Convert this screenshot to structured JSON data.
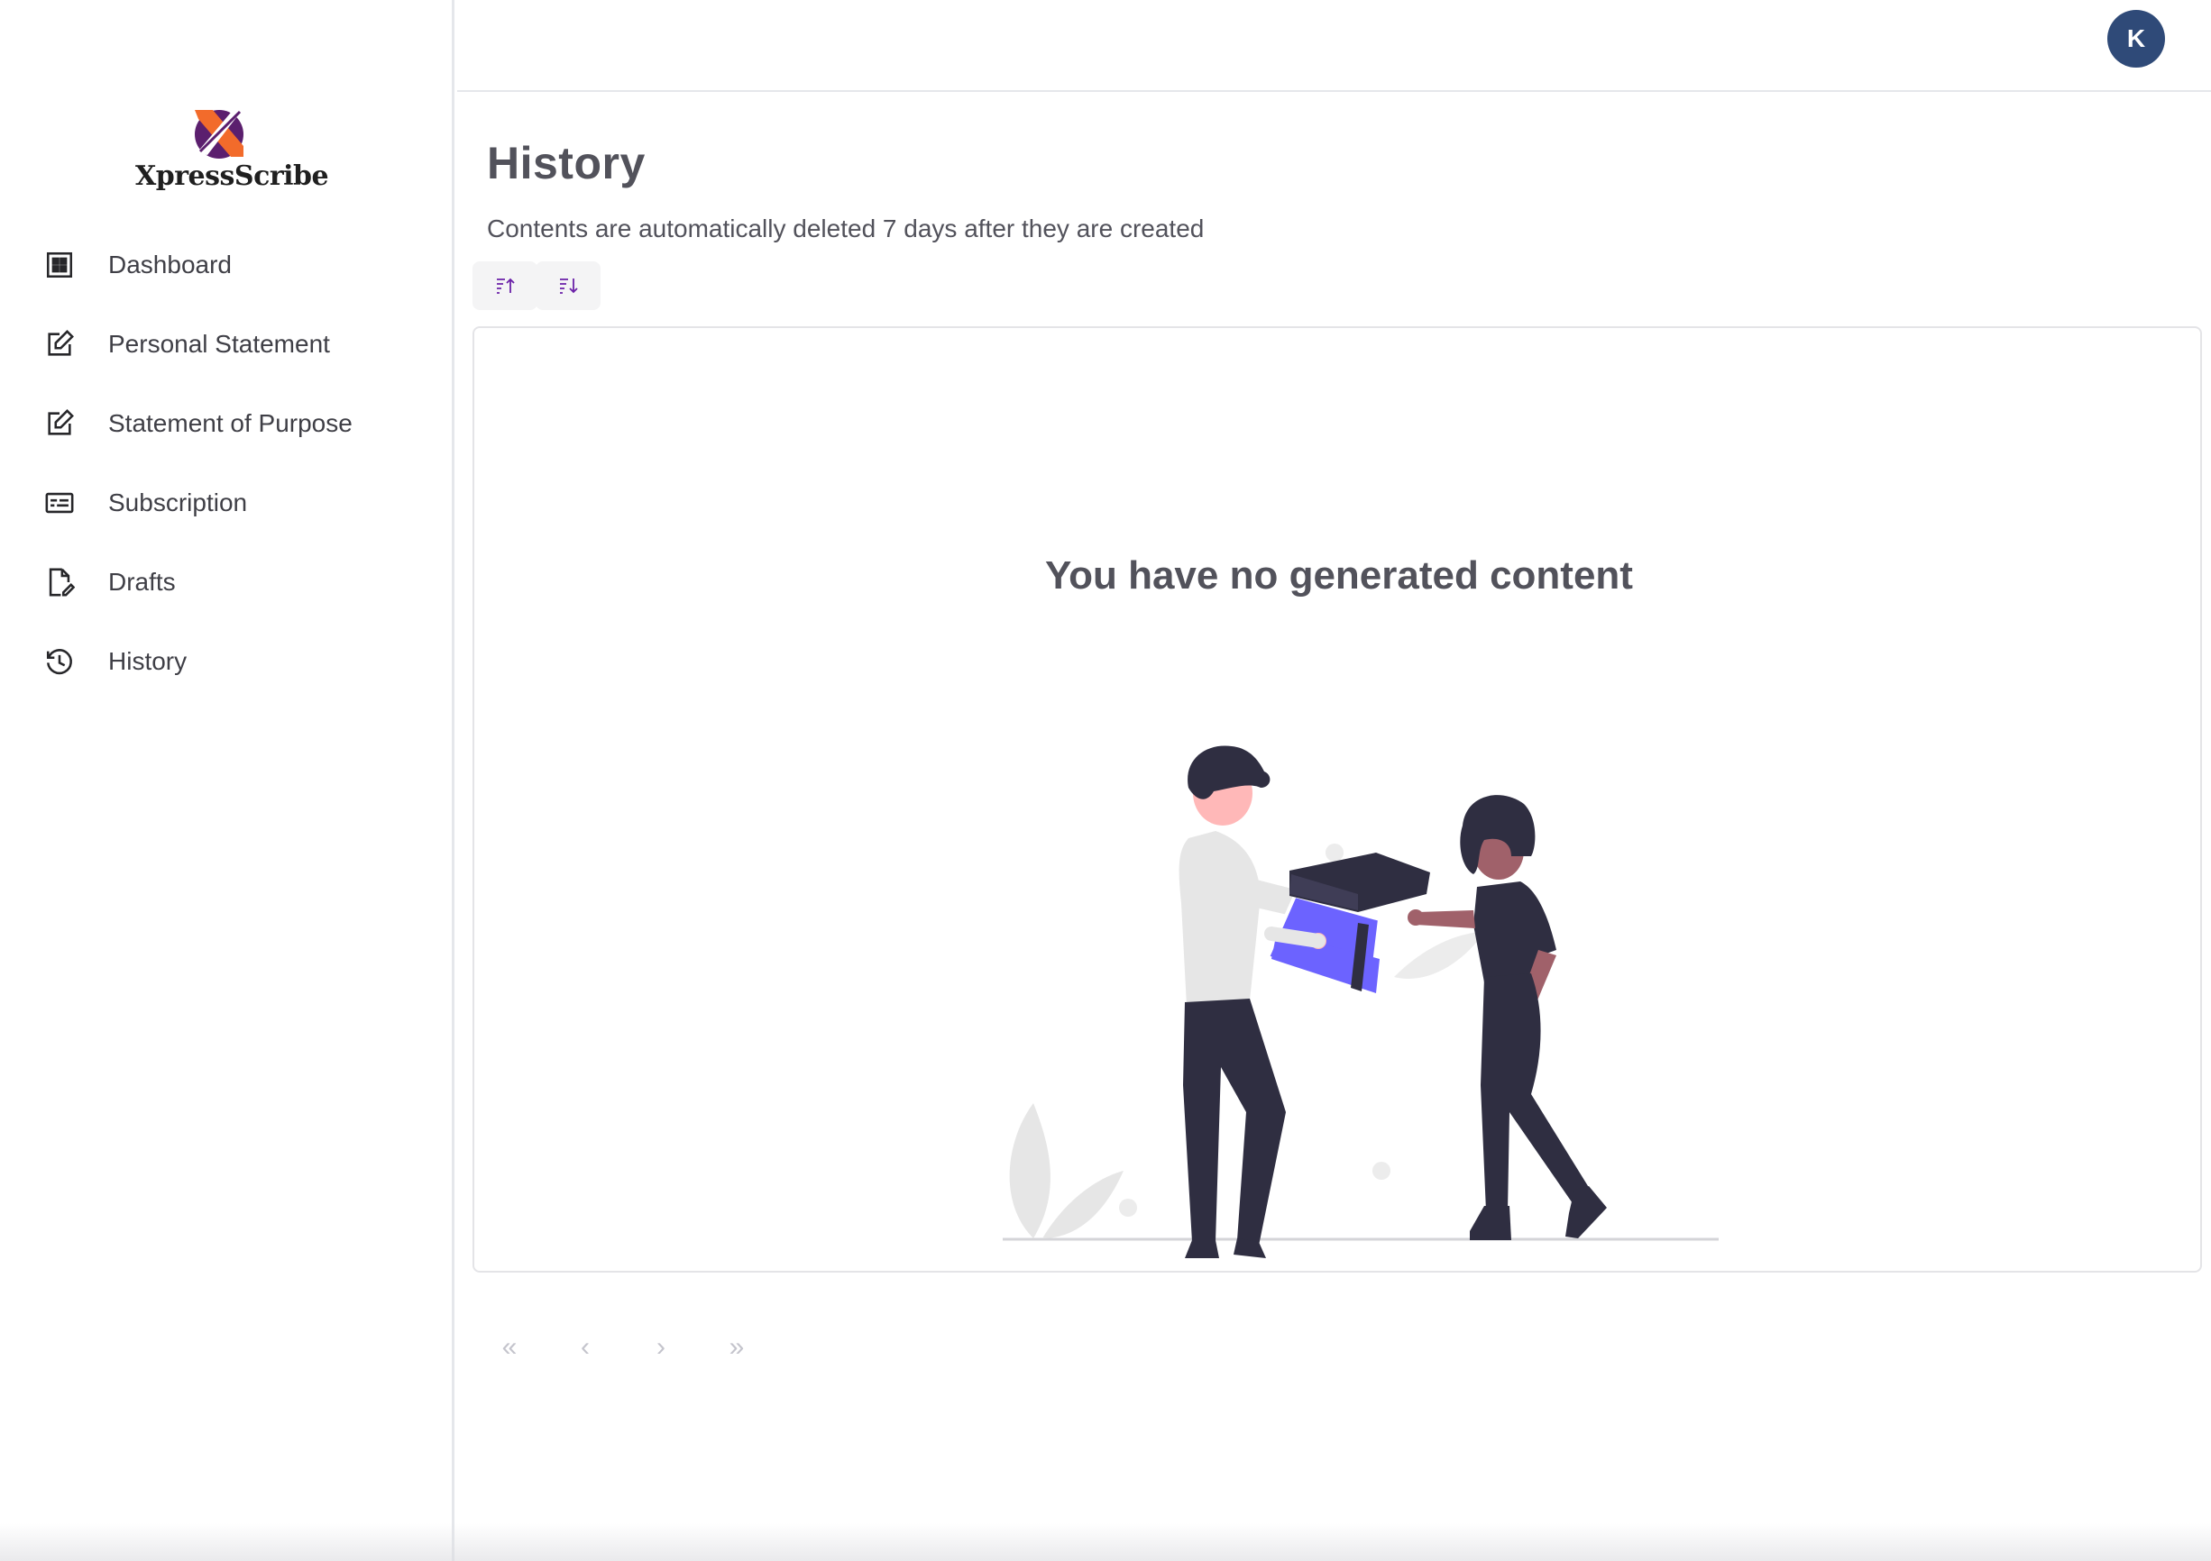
{
  "brand": {
    "name": "XpressScribe"
  },
  "sidebar": {
    "items": [
      {
        "label": "Dashboard",
        "icon": "grid-icon"
      },
      {
        "label": "Personal Statement",
        "icon": "edit-icon"
      },
      {
        "label": "Statement of Purpose",
        "icon": "edit-icon"
      },
      {
        "label": "Subscription",
        "icon": "id-card-icon"
      },
      {
        "label": "Drafts",
        "icon": "document-edit-icon"
      },
      {
        "label": "History",
        "icon": "history-icon"
      }
    ]
  },
  "header": {
    "avatar_initial": "K"
  },
  "main": {
    "title": "History",
    "subtitle": "Contents are automatically deleted 7 days after they are created",
    "sort_buttons": [
      "sort-ascending-icon",
      "sort-descending-icon"
    ],
    "empty_state": {
      "message": "You have no generated content"
    }
  },
  "pagination": {
    "first": "«",
    "prev": "‹",
    "next": "›",
    "last": "»"
  },
  "colors": {
    "avatar_bg": "#2f4a78",
    "illustration_accent": "#6c63ff",
    "illustration_dark": "#2f2e41",
    "logo_purple": "#5b1f6e",
    "logo_orange": "#f26b2b"
  }
}
